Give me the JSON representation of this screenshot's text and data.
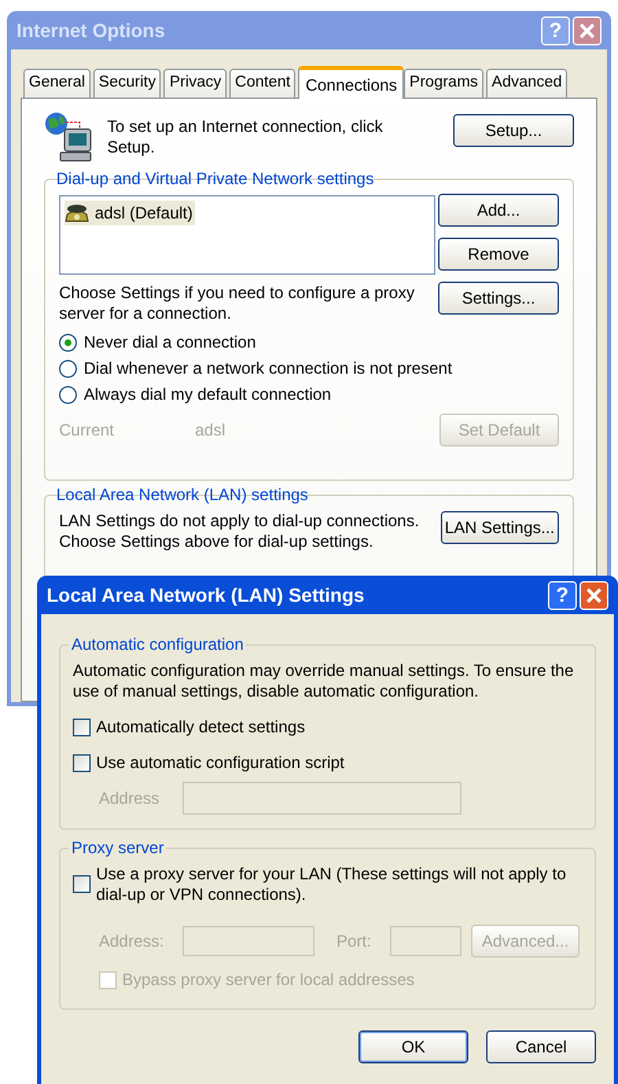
{
  "internet_options": {
    "title": "Internet Options",
    "active": false,
    "help": "?",
    "tabs": [
      {
        "label": "General",
        "selected": false
      },
      {
        "label": "Security",
        "selected": false
      },
      {
        "label": "Privacy",
        "selected": false
      },
      {
        "label": "Content",
        "selected": false
      },
      {
        "label": "Connections",
        "selected": true
      },
      {
        "label": "Programs",
        "selected": false
      },
      {
        "label": "Advanced",
        "selected": false
      }
    ],
    "setup": {
      "text": "To set up an Internet connection, click Setup.",
      "button": "Setup..."
    },
    "dialup": {
      "legend": "Dial-up and Virtual Private Network settings",
      "connections": [
        {
          "label": "adsl (Default)",
          "selected": true
        }
      ],
      "buttons": [
        "Add...",
        "Remove",
        "Settings..."
      ],
      "proxy_note": "Choose Settings if you need to configure a proxy server for a connection.",
      "dial_options": [
        {
          "label": "Never dial a connection",
          "selected": true
        },
        {
          "label": "Dial whenever a network connection is not present",
          "selected": false
        },
        {
          "label": "Always dial my default connection",
          "selected": false
        }
      ],
      "current_label": "Current",
      "current_value": "adsl",
      "set_default": {
        "label": "Set Default",
        "disabled": true
      }
    },
    "lan": {
      "legend": "Local Area Network (LAN) settings",
      "note": "LAN Settings do not apply to dial-up connections. Choose Settings above for dial-up settings.",
      "button": "LAN Settings..."
    }
  },
  "lan_dialog": {
    "title": "Local Area Network (LAN) Settings",
    "active": true,
    "help": "?",
    "auto": {
      "legend": "Automatic configuration",
      "note": "Automatic configuration may override manual settings.  To ensure the use of manual settings, disable automatic configuration.",
      "options": [
        {
          "label": "Automatically detect settings",
          "checked": false
        },
        {
          "label": "Use automatic configuration script",
          "checked": false
        }
      ],
      "address": {
        "label": "Address",
        "disabled": true
      }
    },
    "proxy": {
      "legend": "Proxy server",
      "option": {
        "label": "Use a proxy server for your LAN (These settings will not apply to dial-up or VPN connections).",
        "checked": false
      },
      "disabled": true,
      "address_label": "Address:",
      "port_label": "Port:",
      "advanced": "Advanced...",
      "bypass": {
        "label": "Bypass proxy server for local addresses",
        "checked": false
      }
    },
    "buttons": [
      {
        "label": "OK",
        "default": true
      },
      {
        "label": "Cancel",
        "default": false
      }
    ]
  }
}
